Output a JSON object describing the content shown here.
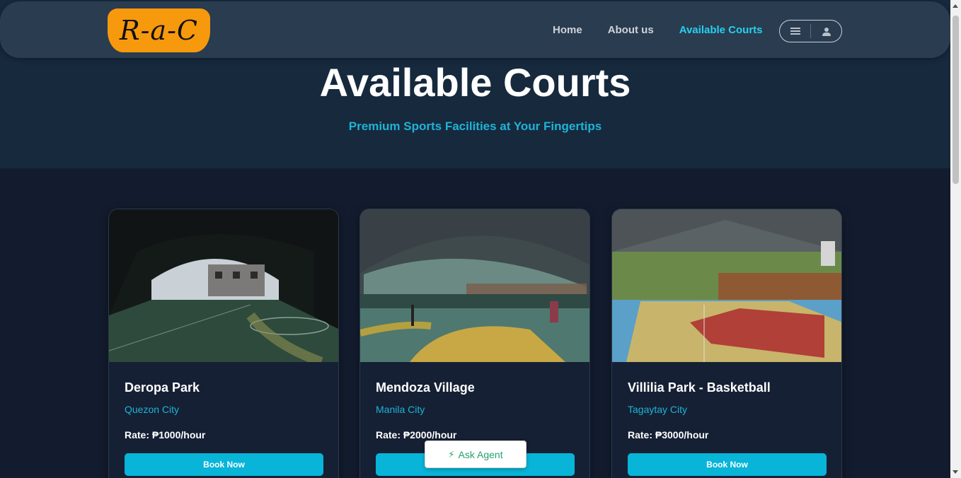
{
  "brand": {
    "logo_text": "R-a-C"
  },
  "nav": {
    "links": [
      {
        "label": "Home",
        "active": false
      },
      {
        "label": "About us",
        "active": false
      },
      {
        "label": "Available Courts",
        "active": true
      }
    ],
    "icons": [
      "menu-icon",
      "user-icon"
    ]
  },
  "hero": {
    "title": "Available Courts",
    "subtitle": "Premium Sports Facilities at Your Fingertips"
  },
  "courts": [
    {
      "name": "Deropa Park",
      "city": "Quezon City",
      "rate": "Rate: ₱1000/hour",
      "button": "Book Now"
    },
    {
      "name": "Mendoza Village",
      "city": "Manila City",
      "rate": "Rate: ₱2000/hour",
      "button": "Book Now"
    },
    {
      "name": "Villilia Park - Basketball",
      "city": "Tagaytay City",
      "rate": "Rate: ₱3000/hour",
      "button": "Book Now"
    }
  ],
  "agent": {
    "label": "Ask Agent",
    "icon": "bolt-icon"
  },
  "colors": {
    "accent": "#08b5d8",
    "brand": "#f7990d",
    "nav_active": "#25d0f0",
    "agent_text": "#23a36d"
  }
}
